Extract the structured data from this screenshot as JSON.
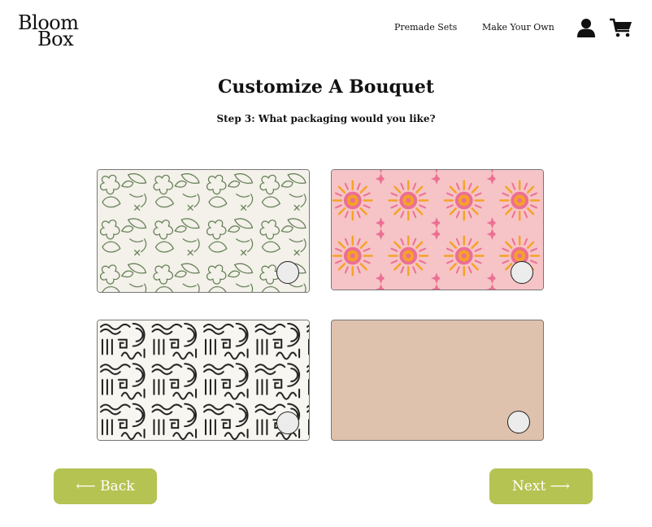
{
  "header": {
    "logo_line1": "Bloom",
    "logo_line2": "Box",
    "nav": [
      {
        "label": "Premade Sets"
      },
      {
        "label": "Make Your Own"
      }
    ],
    "icons": [
      "user-icon",
      "cart-icon"
    ]
  },
  "main": {
    "title": "Customize A Bouquet",
    "step": "Step 3: What packaging would you like?",
    "options": [
      {
        "pattern": "green-floral-line-art",
        "selected": false
      },
      {
        "pattern": "pink-orange-sunburst",
        "selected": false
      },
      {
        "pattern": "black-squiggle-doodle",
        "selected": false
      },
      {
        "pattern": "plain-tan",
        "selected": false
      }
    ]
  },
  "footer": {
    "back_label": "⟵ Back",
    "next_label": "Next ⟶"
  },
  "colors": {
    "accent": "#b5c352",
    "tan": "#dfc2ad",
    "pink": "#f6c4c6",
    "orange": "#f5a227",
    "green_line": "#5f7a4f",
    "cream": "#f3f1ea"
  }
}
